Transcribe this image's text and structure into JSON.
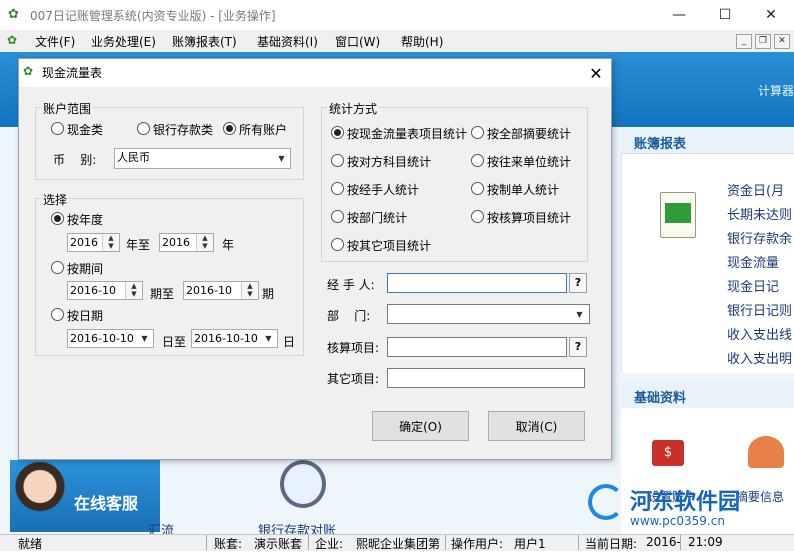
{
  "app": {
    "title": "007日记账管理系统(内资专业版) - [业务操作]"
  },
  "menu": [
    "文件(F)",
    "业务处理(E)",
    "账簿报表(T)",
    "基础资料(I)",
    "窗口(W)",
    "帮助(H)"
  ],
  "toolbar": {
    "calc": "计算器"
  },
  "dialog": {
    "title": "现金流量表",
    "account_range": {
      "label": "账户范围",
      "options": [
        "现金类",
        "银行存款类",
        "所有账户"
      ],
      "selected": "所有账户",
      "currency_label": "币    别:",
      "currency_value": "人民币"
    },
    "select": {
      "label": "选择",
      "by_year": {
        "label": "按年度",
        "from": "2016",
        "sep": "年至",
        "to": "2016",
        "suffix": "年",
        "selected": true
      },
      "by_period": {
        "label": "按期间",
        "from": "2016-10",
        "sep": "期至",
        "to": "2016-10",
        "suffix": "期"
      },
      "by_date": {
        "label": "按日期",
        "from": "2016-10-10",
        "sep": "日至",
        "to": "2016-10-10",
        "suffix": "日"
      }
    },
    "stat_method": {
      "label": "统计方式",
      "options": [
        "按现金流量表项目统计",
        "按全部摘要统计",
        "按对方科目统计",
        "按往来单位统计",
        "按经手人统计",
        "按制单人统计",
        "按部门统计",
        "按核算项目统计",
        "按其它项目统计"
      ],
      "selected": "按现金流量表项目统计"
    },
    "fields": {
      "handler": "经 手 人:",
      "department": "部    门:",
      "account_item": "核算项目:",
      "other_item": "其它项目:"
    },
    "buttons": {
      "ok": "确定(O)",
      "cancel": "取消(C)",
      "help": "?"
    }
  },
  "panels": {
    "ledger": {
      "title": "账簿报表",
      "links": [
        "资金日(月",
        "长期未达则",
        "银行存款余",
        "现金流量",
        "现金日记",
        "银行日记则",
        "收入支出线",
        "收入支出明"
      ]
    },
    "basic": {
      "title": "基础资料",
      "items": [
        "设置账户",
        "摘要信息"
      ]
    },
    "bottom": {
      "service": "在线客服",
      "flow": "汇流",
      "bank_reconcile": "银行存款对账"
    }
  },
  "watermark": {
    "text": "河东软件园",
    "url": "www.pc0359.cn"
  },
  "status": {
    "ready": "就绪",
    "book_label": "账套:",
    "book": "演示账套",
    "company_label": "企业:",
    "company": "熙昵企业集团第",
    "user_label": "操作用户:",
    "user": "用户1",
    "date_label": "当前日期:",
    "date": "2016-",
    "time": "21:09"
  }
}
